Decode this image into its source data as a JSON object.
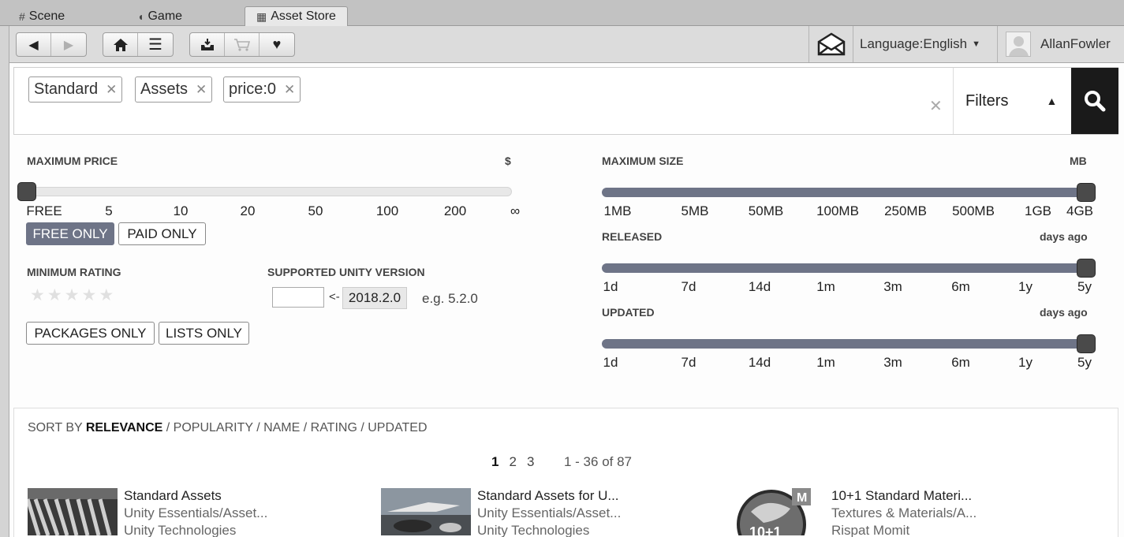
{
  "tabs": [
    {
      "label": "Scene",
      "icon": "grid-icon"
    },
    {
      "label": "Game",
      "icon": "pacman-icon"
    },
    {
      "label": "Asset Store",
      "icon": "bag-icon",
      "active": true
    }
  ],
  "toolbar": {
    "language": "Language:English",
    "username": "AllanFowler"
  },
  "search": {
    "chips": [
      "Standard",
      "Assets",
      "price:0"
    ],
    "filters_label": "Filters"
  },
  "price": {
    "label": "MAXIMUM PRICE",
    "unit": "$",
    "ticks": [
      "FREE",
      "5",
      "10",
      "20",
      "50",
      "100",
      "200",
      "∞"
    ],
    "value": "FREE",
    "free_only": "FREE ONLY",
    "paid_only": "PAID ONLY"
  },
  "size": {
    "label": "MAXIMUM SIZE",
    "unit": "MB",
    "ticks": [
      "1MB",
      "5MB",
      "50MB",
      "100MB",
      "250MB",
      "500MB",
      "1GB",
      "4GB"
    ],
    "value": "4GB"
  },
  "released": {
    "label": "RELEASED",
    "unit": "days ago",
    "ticks": [
      "1d",
      "7d",
      "14d",
      "1m",
      "3m",
      "6m",
      "1y",
      "5y"
    ],
    "value": "5y"
  },
  "updated": {
    "label": "UPDATED",
    "unit": "days ago",
    "ticks": [
      "1d",
      "7d",
      "14d",
      "1m",
      "3m",
      "6m",
      "1y",
      "5y"
    ],
    "value": "5y"
  },
  "rating": {
    "label": "MINIMUM RATING",
    "stars": 5,
    "selected": 0
  },
  "unity_version": {
    "label": "SUPPORTED UNITY VERSION",
    "arrow": "<-",
    "current": "2018.2.0",
    "example": "e.g. 5.2.0"
  },
  "type_buttons": {
    "packages_only": "PACKAGES ONLY",
    "lists_only": "LISTS ONLY"
  },
  "sort": {
    "prefix": "SORT BY",
    "current": "RELEVANCE",
    "others": "/ POPULARITY / NAME / RATING / UPDATED"
  },
  "pagination": {
    "pages": [
      "1",
      "2",
      "3"
    ],
    "current": "1",
    "range": "1 - 36 of 87"
  },
  "results": [
    {
      "title": "Standard Assets",
      "category": "Unity Essentials/Asset...",
      "publisher": "Unity Technologies"
    },
    {
      "title": "Standard Assets for U...",
      "category": "Unity Essentials/Asset...",
      "publisher": "Unity Technologies"
    },
    {
      "title": "10+1 Standard Materi...",
      "category": "Textures & Materials/A...",
      "publisher": "Rispat Momit"
    }
  ],
  "colors": {
    "slider_fill": "#6e7487",
    "knob": "#4a4a4a",
    "search_button": "#1a1a1a"
  }
}
